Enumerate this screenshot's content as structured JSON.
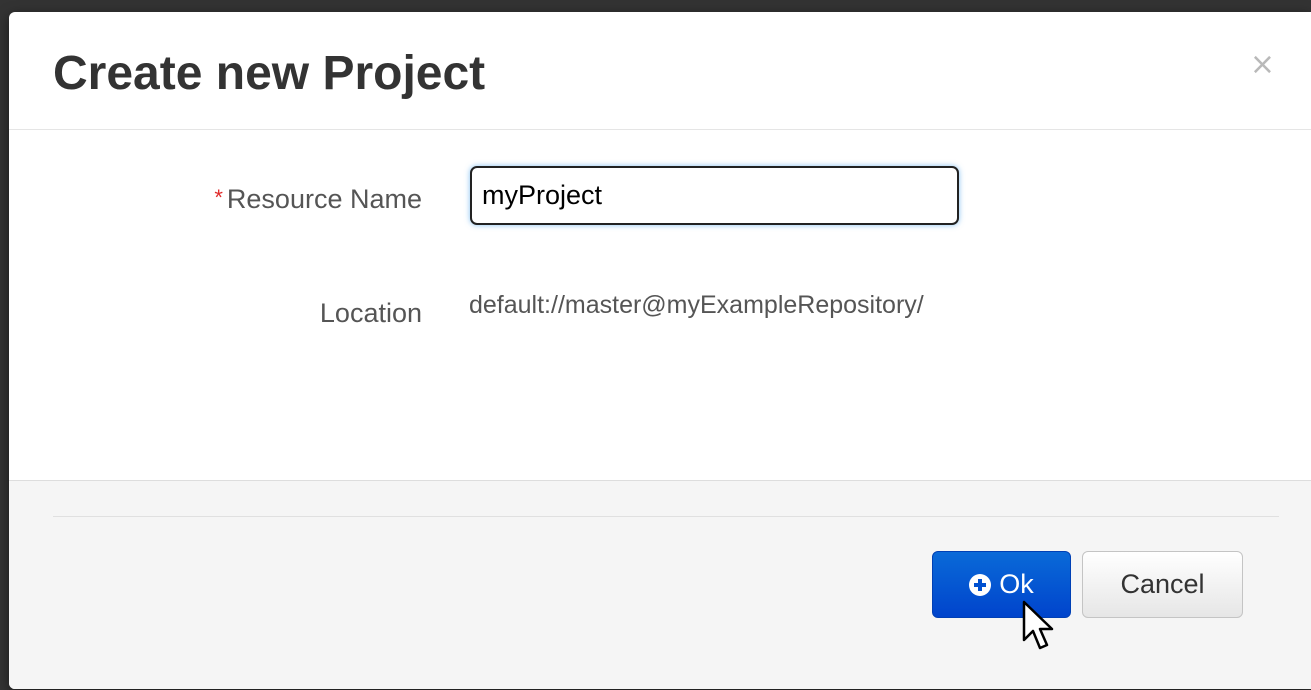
{
  "dialog": {
    "title": "Create new Project",
    "close_label": "×"
  },
  "form": {
    "resource_name": {
      "required_marker": "*",
      "label": "Resource Name",
      "value": "myProject"
    },
    "location": {
      "label": "Location",
      "value": "default://master@myExampleRepository/"
    }
  },
  "footer": {
    "ok_label": "Ok",
    "cancel_label": "Cancel"
  },
  "icons": {
    "ok": "plus-circle-icon",
    "close": "close-icon",
    "pointer": "mouse-pointer-icon"
  },
  "colors": {
    "primary": "#0044cc",
    "required": "#e02a2a"
  }
}
